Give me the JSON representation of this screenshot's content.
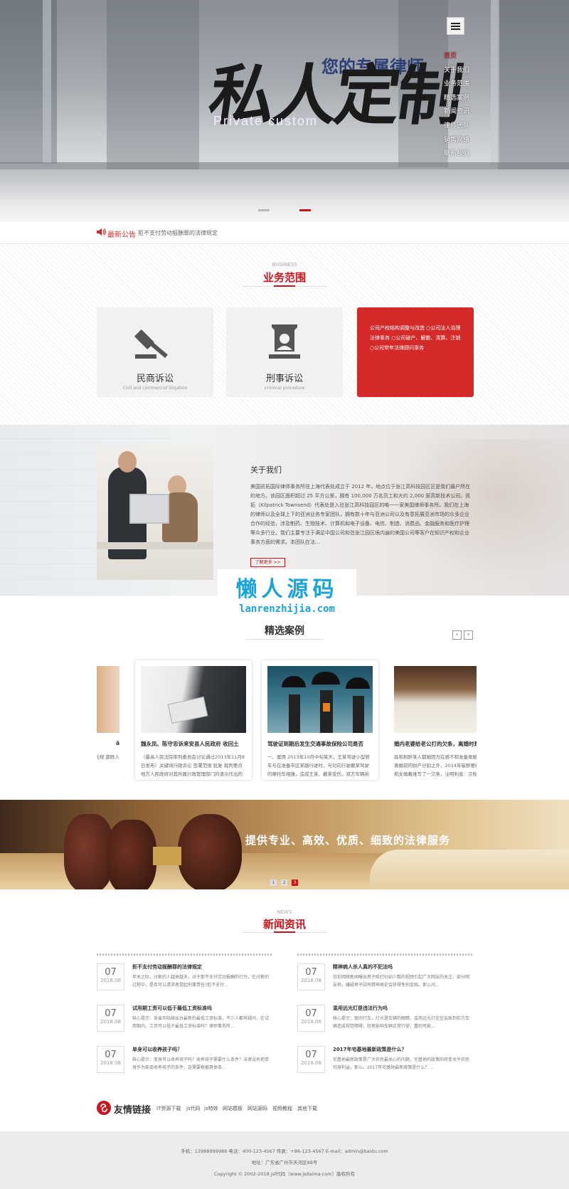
{
  "hero": {
    "title_cn": "私人定制",
    "subtitle": "您的专属律师",
    "title_en": "Private custom",
    "nav": [
      "首页",
      "关于我们",
      "业务范围",
      "精选案例",
      "新闻资讯",
      "律师团队",
      "销售网络",
      "联系我们"
    ]
  },
  "notice": {
    "label": "最新公告",
    "text": "拒不支付劳动报酬罪的法律规定"
  },
  "business": {
    "en": "BUSINESS",
    "cn": "业务范围",
    "cards": [
      {
        "cn": "民商诉讼",
        "en": "Civil and commercial litigation"
      },
      {
        "cn": "刑事诉讼",
        "en": "criminal procedure"
      }
    ],
    "red_card_text": "公司产权结构调整与改造 ○公司法人治理法律事务 ○公司破产、解散、清算、注销 ○公司常年法律顾问事务"
  },
  "about": {
    "title": "关于我们",
    "text": "美国凯拓国际律师事务所驻上海代表处成立于 2012 年，地点位于张江高科技园区区是我们最户所在的地方。该园区面积超过 25 平方公里，拥有 100,000 万名员工和大约 2,000 家高新技术公司。凯拓（Kilpatrick Townsend）代表处是入驻张江高科技园区的唯一一家美国律师事务所。我们在上海的律师以及全球上下的亚洲业务专家团队，拥有数十年与亚洲公司以及有意拓展亚洲市场的众多企业合作的经验，涉及制药、生物技术、计算机和电子设备、电信、制造、消费品、金融服务和医疗护理等众多行业。我们主要专注于满足中国公司和驻张江园区境内遍的美国公司等客户在知识产权和企业事务方面的需求。本团队在法...",
    "more": "了解更多 >>"
  },
  "watermark": {
    "cn": "懒人源码",
    "en": "lanrenzhijia.com"
  },
  "cases": {
    "cn": "精选案例",
    "prev": "‹",
    "next": "›",
    "items": [
      {
        "title": "ā",
        "desc": "元规 邵欧人"
      },
      {
        "title": "魏永凤、陈守忠诉来安县人民政府 收回土",
        "desc": "（最高人民法院审判委员会讨论通过2013年11月8日发布）关键词行政诉讼 签署范围 批复 裁判要点 地方人民政府对其所属行政管理部门的请示作出的批复..."
      },
      {
        "title": "驾驶证到期后发生交通事故保险公司是否",
        "desc": "一、案情 2013年10月中旬某天，王某驾驶小型轿车与在准备市区某路行驶时，与对向行驶戴某驾驶的摩托车相撞，造成王某、戴某受伤，双方车辆损坏。后查..."
      },
      {
        "title": "婚内老婆给老公打的欠条，离婚时是否有",
        "desc": "昌和和醉某人都婚因为在感不和准备离婚，铁了，离婚前的财产分割之外，2014年崔醉要给他的千利和女婚戴维写了一欠条，注明利息：次权借于利60万角，一共..."
      }
    ]
  },
  "banner": {
    "text": "提供专业、高效、优质、细致的法律服务",
    "dots": [
      "1",
      "2",
      "3"
    ]
  },
  "news": {
    "en": "NEWS",
    "cn": "新闻资讯",
    "left": [
      {
        "day": "07",
        "ym": "2018.08",
        "title": "拒不支付劳动报酬罪的法律规定",
        "desc": "年关之际，讨薪的人越来越多，对于那不支付劳动报酬的行为，在讨薪的过程中，是否可以请求者提起刑事责任?拒不支付..."
      },
      {
        "day": "07",
        "ym": "2018.08",
        "title": "试用期工资可以低于最低工资标准吗",
        "desc": "核心提示：各省市陆续出台最新的最低工资标准，不少人都有疑问，在试用期内，工资可以低于最低工资标准吗？律师事务所..."
      },
      {
        "day": "07",
        "ym": "2018.08",
        "title": "单身可以收养孩子吗？",
        "desc": "核心提示：单身可以收养孩子吗？收养孩子需要什么条件？法律没有把单身作为能否收养孩子的条件，这需要根据具体条..."
      }
    ],
    "right": [
      {
        "day": "07",
        "ym": "2018.08",
        "title": "精神病人杀人真的不犯法吗",
        "desc": "日前网络新闻曝出男子殴打妇幼少数的视频引起广大网友的关注，部分网友称，嫌疑男子因有精神病史会获得免刑金赔。那么问..."
      },
      {
        "day": "07",
        "ym": "2018.08",
        "title": "滥用远光灯是违法行为吗",
        "desc": "核心提示：夜间行车，灯光是车辆的眼睛。滥用远光灯往往会致到前方车辆造成视觉障碍，轻者影响车辆正常行驶，重则可能..."
      },
      {
        "day": "07",
        "ym": "2018.08",
        "title": "2017年宅基地最新政策是什么？",
        "desc": "宅基地最新政策是广大农民最关心的问题，宅基地的政策的转变关乎农民切身利益。那么，2017年宅基地最新政策是什么？..."
      }
    ]
  },
  "links": {
    "title": "友情链接",
    "items": [
      "IT资源下载",
      "js代码",
      "js特效",
      "网站模板",
      "网站源码",
      "视频教程",
      "其他下载"
    ]
  },
  "footer": {
    "line1": "手机：13988999988 电话：400-123-4567 传真：+86-123-4567 E-mail：admin@baidu.com",
    "line2": "地址：广东省广州市天河区88号",
    "line3": "Copyright © 2002-2018 jsf代码（www.jsdaima.com）版权所有"
  },
  "colors": {
    "accent": "#c8161e",
    "red_card": "#d42a2a",
    "watermark": "#19a3d8"
  }
}
